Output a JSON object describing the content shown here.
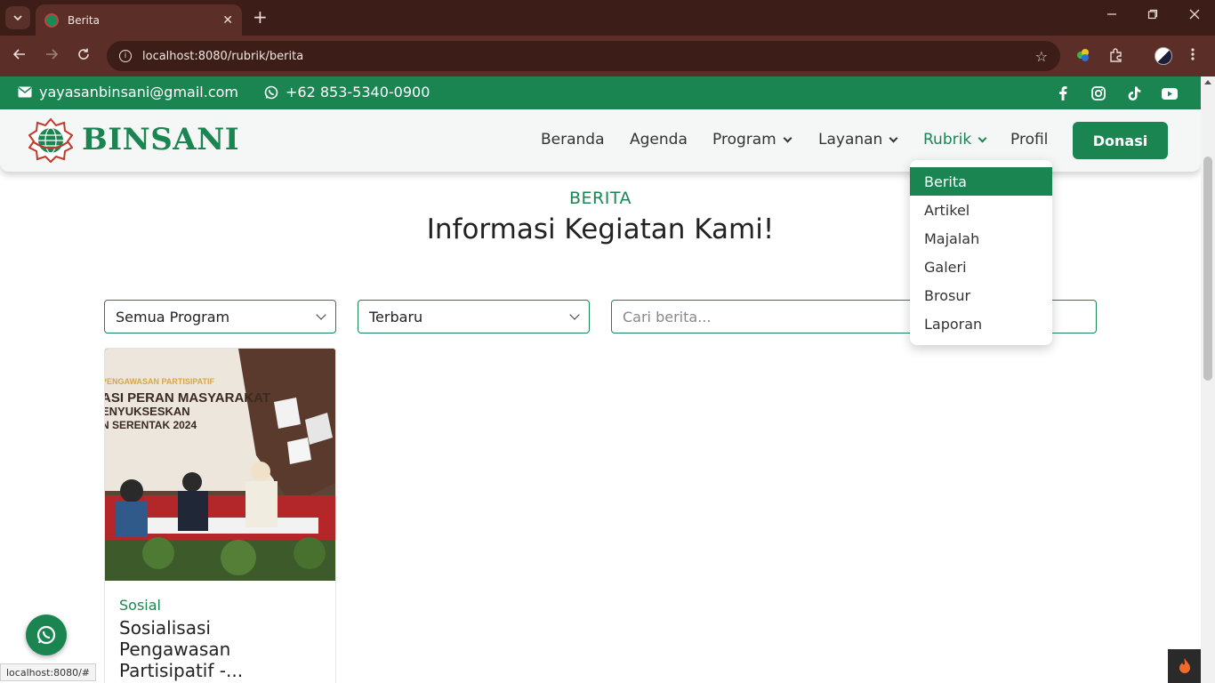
{
  "browser": {
    "tab_title": "Berita",
    "tab_close": "✕",
    "new_tab": "+",
    "url": "localhost:8080/rubrik/berita",
    "status_url": "localhost:8080/#"
  },
  "topbar": {
    "email": "yayasanbinsani@gmail.com",
    "phone": "+62 853-5340-0900",
    "social_icons": [
      "facebook-icon",
      "instagram-icon",
      "tiktok-icon",
      "youtube-icon"
    ]
  },
  "navbar": {
    "brand": "BINSANI",
    "links": {
      "beranda": "Beranda",
      "agenda": "Agenda",
      "program": "Program",
      "layanan": "Layanan",
      "rubrik": "Rubrik",
      "profil": "Profil"
    },
    "donate_label": "Donasi"
  },
  "dropdown": {
    "items": [
      "Berita",
      "Artikel",
      "Majalah",
      "Galeri",
      "Brosur",
      "Laporan"
    ],
    "active": "Berita"
  },
  "section": {
    "label": "BERITA",
    "title": "Informasi Kegiatan Kami!"
  },
  "filters": {
    "program_selected": "Semua Program",
    "sort_selected": "Terbaru",
    "search_placeholder": "Cari berita..."
  },
  "cards": [
    {
      "category": "Sosial",
      "title": "Sosialisasi Pengawasan Partisipatif -...",
      "image_text": {
        "line1": "PENGAWASAN PARTISIPATIF",
        "line2": "ASI PERAN MASYARAKAT",
        "line3": "ENYUKSESKAN",
        "line4": "N SERENTAK 2024"
      }
    }
  ],
  "colors": {
    "brand_green": "#1b8552",
    "chrome_dark": "#3c1d17",
    "chrome_mid": "#5b2f27"
  }
}
